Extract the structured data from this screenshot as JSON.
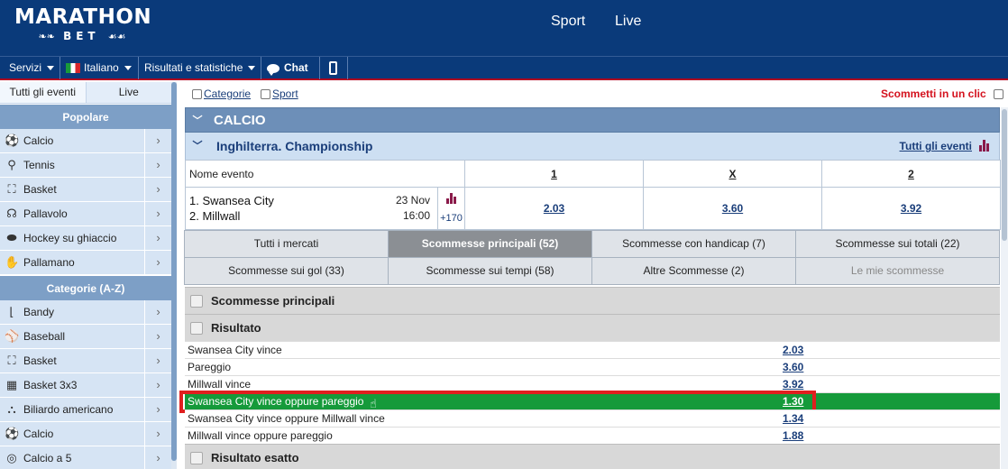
{
  "header": {
    "logo_main": "MARATHON",
    "logo_sub": "BET",
    "nav": [
      "Sport",
      "Live"
    ]
  },
  "toolbar": {
    "servizi": "Servizi",
    "language": "Italiano",
    "results": "Risultati e statistiche",
    "chat": "Chat"
  },
  "sidebar": {
    "tabs": [
      "Tutti gli eventi",
      "Live"
    ],
    "popular_title": "Popolare",
    "popular": [
      {
        "label": "Calcio",
        "icon": "soccer-ball-icon"
      },
      {
        "label": "Tennis",
        "icon": "tennis-racket-icon"
      },
      {
        "label": "Basket",
        "icon": "basketball-icon"
      },
      {
        "label": "Pallavolo",
        "icon": "volleyball-icon"
      },
      {
        "label": "Hockey su ghiaccio",
        "icon": "hockey-puck-icon"
      },
      {
        "label": "Pallamano",
        "icon": "handball-icon"
      }
    ],
    "categories_title": "Categorie (A-Z)",
    "categories": [
      {
        "label": "Bandy",
        "icon": "bandy-stick-icon"
      },
      {
        "label": "Baseball",
        "icon": "baseball-icon"
      },
      {
        "label": "Basket",
        "icon": "basketball-icon"
      },
      {
        "label": "Basket 3x3",
        "icon": "basket-3x3-icon"
      },
      {
        "label": "Biliardo americano",
        "icon": "billiard-balls-icon"
      },
      {
        "label": "Calcio",
        "icon": "soccer-ball-icon"
      },
      {
        "label": "Calcio a 5",
        "icon": "futsal-ball-icon"
      }
    ]
  },
  "filters": {
    "categorie": "Categorie",
    "sport": "Sport",
    "one_click": "Scommetti in un clic"
  },
  "sport_title": "CALCIO",
  "league": {
    "title": "Inghilterra. Championship",
    "all_events": "Tutti gli eventi"
  },
  "event_table": {
    "col_event": "Nome evento",
    "col_1": "1",
    "col_x": "X",
    "col_2": "2",
    "team1": "1. Swansea City",
    "team2": "2. Millwall",
    "date": "23 Nov",
    "time": "16:00",
    "more_markets": "+170",
    "odd_1": "2.03",
    "odd_x": "3.60",
    "odd_2": "3.92"
  },
  "market_tabs": [
    [
      "Tutti i mercati",
      "Scommesse principali (52)",
      "Scommesse con handicap (7)",
      "Scommesse sui totali (22)"
    ],
    [
      "Scommesse sui gol (33)",
      "Scommesse sui tempi (58)",
      "Altre Scommesse (2)",
      "Le mie scommesse"
    ]
  ],
  "sections": {
    "main": "Scommesse principali",
    "result": "Risultato",
    "exact": "Risultato esatto"
  },
  "outcomes": [
    {
      "name": "Swansea City vince",
      "odd": "2.03"
    },
    {
      "name": "Pareggio",
      "odd": "3.60"
    },
    {
      "name": "Millwall vince",
      "odd": "3.92"
    },
    {
      "name": "Swansea City vince oppure pareggio",
      "odd": "1.30"
    },
    {
      "name": "Swansea City vince oppure Millwall vince",
      "odd": "1.34"
    },
    {
      "name": "Millwall vince oppure pareggio",
      "odd": "1.88"
    }
  ],
  "colors": {
    "brand_navy": "#0a3a7a",
    "selected_green": "#159a3a",
    "highlight_red": "#e01f1f",
    "one_click_red": "#d4121e"
  }
}
